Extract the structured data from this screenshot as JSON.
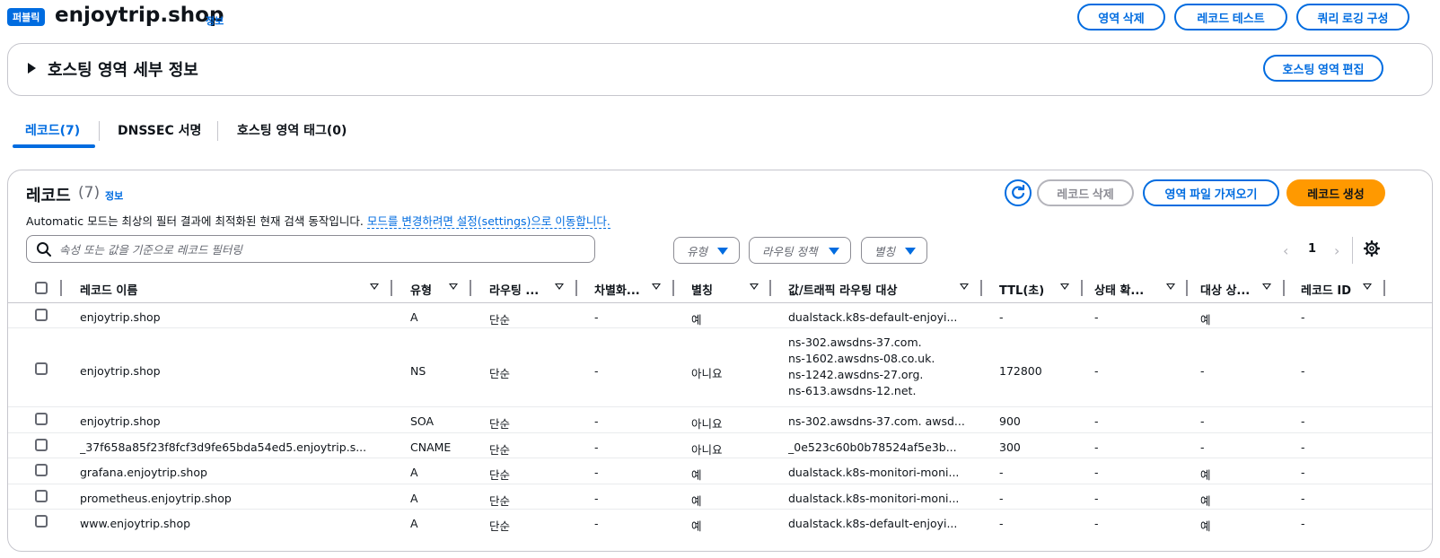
{
  "header": {
    "badge": "퍼블릭",
    "zone_name": "enjoytrip.shop",
    "info": "정보",
    "buttons": {
      "delete_zone": "영역 삭제",
      "test_record": "레코드 테스트",
      "query_logging": "쿼리 로깅 구성"
    }
  },
  "details": {
    "title": "호스팅 영역 세부 정보",
    "edit_button": "호스팅 영역 편집"
  },
  "tabs": [
    {
      "label": "레코드(7)",
      "active": true
    },
    {
      "label": "DNSSEC 서명",
      "active": false
    },
    {
      "label": "호스팅 영역 태그(0)",
      "active": false
    }
  ],
  "records": {
    "title": "레코드",
    "count": "(7)",
    "info": "정보",
    "description": "Automatic 모드는 최상의 필터 결과에 최적화된 현재 검색 동작입니다.",
    "description_link": "모드를 변경하려면 설정(settings)으로 이동합니다.",
    "buttons": {
      "delete_record": "레코드 삭제",
      "import_zone_file": "영역 파일 가져오기",
      "create_record": "레코드 생성"
    },
    "search_placeholder": "속성 또는 값을 기준으로 레코드 필터링",
    "filters": {
      "type": "유형",
      "routing_policy": "라우팅 정책",
      "alias": "별칭"
    },
    "page": "1",
    "columns": [
      "레코드 이름",
      "유형",
      "라우팅 ...",
      "차별화...",
      "별칭",
      "값/트래픽 라우팅 대상",
      "TTL(초)",
      "상태 확...",
      "대상 상...",
      "레코드 ID"
    ],
    "rows": [
      {
        "name": "enjoytrip.shop",
        "type": "A",
        "routing": "단순",
        "diff": "-",
        "alias": "예",
        "value": "dualstack.k8s-default-enjoyi...",
        "ttl": "-",
        "health": "-",
        "eval": "예",
        "id": "-"
      },
      {
        "name": "enjoytrip.shop",
        "type": "NS",
        "routing": "단순",
        "diff": "-",
        "alias": "아니요",
        "value": "ns-302.awsdns-37.com.\nns-1602.awsdns-08.co.uk.\nns-1242.awsdns-27.org.\nns-613.awsdns-12.net.",
        "ttl": "172800",
        "health": "-",
        "eval": "-",
        "id": "-"
      },
      {
        "name": "enjoytrip.shop",
        "type": "SOA",
        "routing": "단순",
        "diff": "-",
        "alias": "아니요",
        "value": "ns-302.awsdns-37.com. awsd...",
        "ttl": "900",
        "health": "-",
        "eval": "-",
        "id": "-"
      },
      {
        "name": "_37f658a85f23f8fcf3d9fe65bda54ed5.enjoytrip.s...",
        "type": "CNAME",
        "routing": "단순",
        "diff": "-",
        "alias": "아니요",
        "value": "_0e523c60b0b78524af5e3b...",
        "ttl": "300",
        "health": "-",
        "eval": "-",
        "id": "-"
      },
      {
        "name": "grafana.enjoytrip.shop",
        "type": "A",
        "routing": "단순",
        "diff": "-",
        "alias": "예",
        "value": "dualstack.k8s-monitori-moni...",
        "ttl": "-",
        "health": "-",
        "eval": "예",
        "id": "-"
      },
      {
        "name": "prometheus.enjoytrip.shop",
        "type": "A",
        "routing": "단순",
        "diff": "-",
        "alias": "예",
        "value": "dualstack.k8s-monitori-moni...",
        "ttl": "-",
        "health": "-",
        "eval": "예",
        "id": "-"
      },
      {
        "name": "www.enjoytrip.shop",
        "type": "A",
        "routing": "단순",
        "diff": "-",
        "alias": "예",
        "value": "dualstack.k8s-default-enjoyi...",
        "ttl": "-",
        "health": "-",
        "eval": "예",
        "id": "-"
      }
    ]
  }
}
